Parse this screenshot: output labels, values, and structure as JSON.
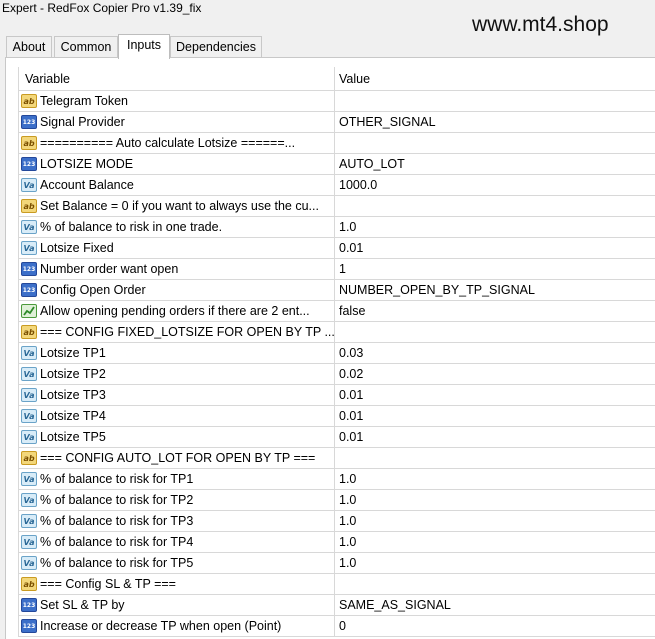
{
  "window": {
    "title": "Expert - RedFox Copier Pro v1.39_fix",
    "watermark": "www.mt4.shop"
  },
  "tabs": [
    {
      "label": "About",
      "active": false
    },
    {
      "label": "Common",
      "active": false
    },
    {
      "label": "Inputs",
      "active": true
    },
    {
      "label": "Dependencies",
      "active": false
    }
  ],
  "grid": {
    "columns": {
      "variable": "Variable",
      "value": "Value"
    },
    "rows": [
      {
        "icon": "ab",
        "variable": "Telegram Token",
        "value": ""
      },
      {
        "icon": "123",
        "variable": "Signal Provider",
        "value": "OTHER_SIGNAL"
      },
      {
        "icon": "ab",
        "variable": "========== Auto calculate Lotsize ======...",
        "value": ""
      },
      {
        "icon": "123",
        "variable": "LOTSIZE MODE",
        "value": "AUTO_LOT"
      },
      {
        "icon": "va",
        "variable": "Account Balance",
        "value": "1000.0"
      },
      {
        "icon": "ab",
        "variable": "Set Balance = 0 if you want to always use the cu...",
        "value": ""
      },
      {
        "icon": "va",
        "variable": "% of balance to risk in one trade.",
        "value": "1.0"
      },
      {
        "icon": "va",
        "variable": "Lotsize Fixed",
        "value": "0.01"
      },
      {
        "icon": "123",
        "variable": "Number order want open",
        "value": "1"
      },
      {
        "icon": "123",
        "variable": "Config Open Order",
        "value": "NUMBER_OPEN_BY_TP_SIGNAL"
      },
      {
        "icon": "bool",
        "variable": "Allow opening pending orders if there are 2 ent...",
        "value": "false"
      },
      {
        "icon": "ab",
        "variable": "=== CONFIG FIXED_LOTSIZE FOR OPEN BY TP ...",
        "value": ""
      },
      {
        "icon": "va",
        "variable": "Lotsize TP1",
        "value": "0.03"
      },
      {
        "icon": "va",
        "variable": "Lotsize TP2",
        "value": "0.02"
      },
      {
        "icon": "va",
        "variable": "Lotsize TP3",
        "value": "0.01"
      },
      {
        "icon": "va",
        "variable": "Lotsize TP4",
        "value": "0.01"
      },
      {
        "icon": "va",
        "variable": "Lotsize TP5",
        "value": "0.01"
      },
      {
        "icon": "ab",
        "variable": "=== CONFIG AUTO_LOT FOR OPEN BY TP ===",
        "value": ""
      },
      {
        "icon": "va",
        "variable": "% of balance to risk for TP1",
        "value": "1.0"
      },
      {
        "icon": "va",
        "variable": "% of balance to risk for TP2",
        "value": "1.0"
      },
      {
        "icon": "va",
        "variable": "% of balance to risk for TP3",
        "value": "1.0"
      },
      {
        "icon": "va",
        "variable": "% of balance to risk for TP4",
        "value": "1.0"
      },
      {
        "icon": "va",
        "variable": "% of balance to risk for TP5",
        "value": "1.0"
      },
      {
        "icon": "ab",
        "variable": "=== Config SL & TP ===",
        "value": ""
      },
      {
        "icon": "123",
        "variable": "Set SL & TP by",
        "value": "SAME_AS_SIGNAL"
      },
      {
        "icon": "123",
        "variable": "Increase or decrease TP when open (Point)",
        "value": "0"
      }
    ]
  }
}
